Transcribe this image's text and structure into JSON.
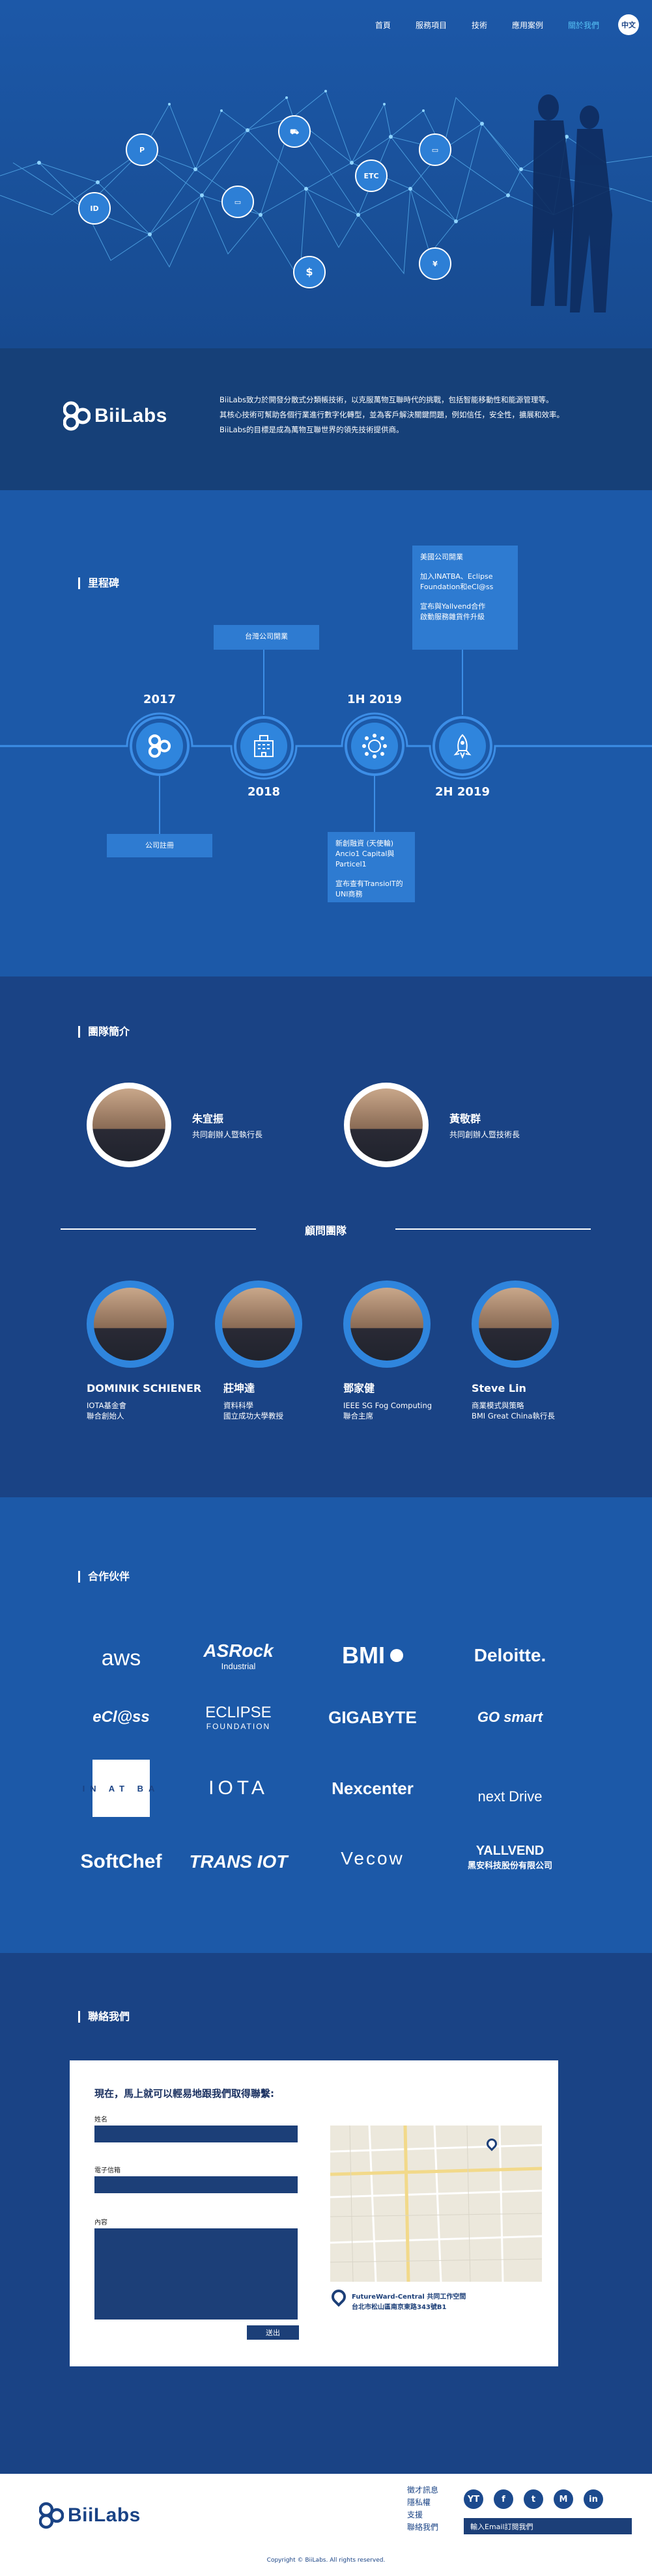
{
  "nav": {
    "items": [
      "首頁",
      "服務項目",
      "技術",
      "應用案例",
      "關於我們"
    ],
    "active_index": 4,
    "lang": "中文"
  },
  "brand": {
    "name": "BiiLabs"
  },
  "intro": {
    "lines": [
      "BiiLabs致力於開發分散式分類帳技術，以克服萬物互聯時代的挑戰，包括智能移動性和能源管理等。",
      "其核心技術可幫助各個行業進行數字化轉型，並為客戶解決關鍵問題，例如信任，安全性，擴展和效率。",
      "BiiLabs的目標是成為萬物互聯世界的領先技術提供商。"
    ]
  },
  "milestones": {
    "title": "里程碑",
    "box_2018": "台灣公司開業",
    "box_2017": "公司註冊",
    "box_1h2019": [
      "新創融資 (天使輪)",
      "Ancio1 Capital與Particel1",
      "宣布查有TransiolT的",
      "UNI商務"
    ],
    "box_2h2019": [
      "美國公司開業",
      "加入INATBA、Eclipse",
      "Foundation和eCl@ss",
      "宣布與Yallvend合作",
      "啟動服務雜貨件升級"
    ],
    "years": [
      "2017",
      "2018",
      "1H 2019",
      "2H 2019"
    ]
  },
  "team": {
    "title": "團隊簡介",
    "members": [
      {
        "name": "朱宜振",
        "role": "共同創辦人暨執行長"
      },
      {
        "name": "黃敬群",
        "role": "共同創辦人暨技術長"
      }
    ],
    "advisors_title": "顧問團隊",
    "advisors": [
      {
        "name": "DOMINIK SCHIENER",
        "role": [
          "IOTA基金會",
          "聯合創始人"
        ]
      },
      {
        "name": "莊坤達",
        "role": [
          "資料科學",
          "國立成功大學教授"
        ]
      },
      {
        "name": "鄧家健",
        "role": [
          "IEEE SG Fog Computing",
          "聯合主席"
        ]
      },
      {
        "name": "Steve Lin",
        "role": [
          "商業模式與策略",
          "BMI Great China執行長"
        ]
      }
    ]
  },
  "partners": {
    "title": "合作伙伴",
    "logos": [
      {
        "name": "aws",
        "icon": "aws-logo"
      },
      {
        "name": "ASRock",
        "sub": "Industrial",
        "icon": "asrock-logo"
      },
      {
        "name": "BMI",
        "icon": "bmi-logo"
      },
      {
        "name": "Deloitte.",
        "icon": "deloitte-logo"
      },
      {
        "name": "eCl@ss",
        "icon": "eclass-logo"
      },
      {
        "name": "ECLIPSE",
        "sub": "FOUNDATION",
        "icon": "eclipse-logo"
      },
      {
        "name": "GIGABYTE",
        "icon": "gigabyte-logo"
      },
      {
        "name": "GO smart",
        "icon": "gosmart-logo"
      },
      {
        "name": "IN AT BA",
        "icon": "inatba-logo"
      },
      {
        "name": "IOTA",
        "icon": "iota-logo"
      },
      {
        "name": "Nexcenter",
        "icon": "nexcenter-logo"
      },
      {
        "name": "next Drive",
        "icon": "nextdrive-logo"
      },
      {
        "name": "SoftChef",
        "icon": "softchef-logo"
      },
      {
        "name": "TRANS IOT",
        "icon": "transiot-logo"
      },
      {
        "name": "Vecow",
        "icon": "vecow-logo"
      },
      {
        "name": "YALLVEND",
        "sub": "黑安科技股份有限公司",
        "icon": "yallvend-logo"
      }
    ]
  },
  "contact": {
    "title": "聯絡我們",
    "heading": "現在，馬上就可以輕易地跟我們取得聯繫:",
    "name_label": "姓名",
    "email_label": "電子信箱",
    "message_label": "內容",
    "send": "送出",
    "address_title": "FutureWard-Central 共同工作空間",
    "address": "台北市松山區南京東路343號B1"
  },
  "footer": {
    "links": [
      "徵才訊息",
      "隱私權",
      "支援",
      "聯絡我們"
    ],
    "social": [
      "YT",
      "f",
      "t",
      "M",
      "in"
    ],
    "subscribe": "輸入Email訂閱我們",
    "copyright": "Copyright © BiiLabs. All rights reserved."
  },
  "colors": {
    "accent": "#56c1f5",
    "dark_blue": "#1a4385",
    "mid_blue": "#1c59a8"
  }
}
